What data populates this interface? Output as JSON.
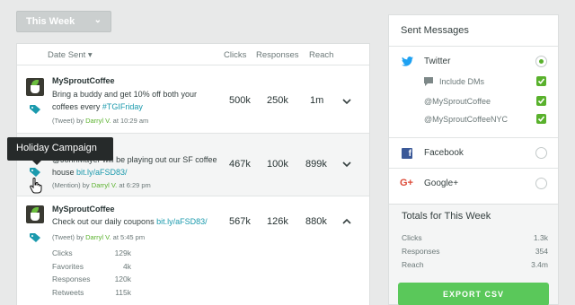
{
  "filter": {
    "range_label": "This Week"
  },
  "table": {
    "headers": {
      "date": "Date Sent",
      "clicks": "Clicks",
      "responses": "Responses",
      "reach": "Reach"
    },
    "rows": [
      {
        "account": "MySproutCoffee",
        "text": "Bring a buddy and get 10% off both your coffees every ",
        "link": "#TGIFriday",
        "meta_prefix": "(Tweet) by ",
        "author": "Darryl V.",
        "meta_suffix": " at 10:29 am",
        "clicks": "500k",
        "responses": "250k",
        "reach": "1m"
      },
      {
        "text": "@JohnMayer will be playing out our SF coffee house ",
        "link": "bit.ly/aFSD83/",
        "meta_prefix": "(Mention) by ",
        "author": "Darryl V.",
        "meta_suffix": " at 6:29 pm",
        "clicks": "467k",
        "responses": "100k",
        "reach": "899k"
      },
      {
        "account": "MySproutCoffee",
        "text": "Check out our daily coupons ",
        "link": "bit.ly/aFSD83/",
        "meta_prefix": "(Tweet) by ",
        "author": "Darryl V.",
        "meta_suffix": " at 5:45 pm",
        "clicks": "567k",
        "responses": "126k",
        "reach": "880k",
        "stats": [
          {
            "label": "Clicks",
            "value": "129k"
          },
          {
            "label": "Favorites",
            "value": "4k"
          },
          {
            "label": "Responses",
            "value": "120k"
          },
          {
            "label": "Retweets",
            "value": "115k"
          }
        ]
      }
    ]
  },
  "tooltip": {
    "text": "Holiday Campaign"
  },
  "sent_messages": {
    "title": "Sent Messages",
    "twitter": {
      "label": "Twitter",
      "include_dms": "Include DMs",
      "profiles": [
        "@MySproutCoffee",
        "@MySproutCoffeeNYC"
      ]
    },
    "facebook": {
      "label": "Facebook"
    },
    "googleplus": {
      "label": "Google+"
    }
  },
  "totals": {
    "title": "Totals for This Week",
    "rows": [
      {
        "label": "Clicks",
        "value": "1.3k"
      },
      {
        "label": "Responses",
        "value": "354"
      },
      {
        "label": "Reach",
        "value": "3.4m"
      }
    ],
    "export_label": "EXPORT CSV"
  },
  "colors": {
    "accent_green": "#59b12c",
    "link_teal": "#1b9aad",
    "export_green": "#5ac85a",
    "twitter_blue": "#1da1f2",
    "facebook_blue": "#3b5998",
    "googleplus_red": "#dd4b39"
  }
}
